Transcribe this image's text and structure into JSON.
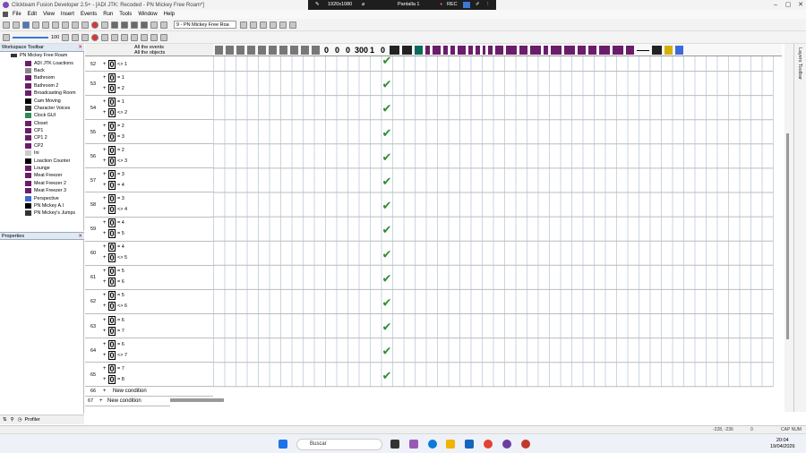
{
  "window": {
    "title": "Clickteam Fusion Developer 2.5+ - [ADI JTK: Recoded - PN Mickey Free Roam*]"
  },
  "recorder": {
    "resolution": "1920x1080",
    "screen": "Pantalla 1",
    "rec": "REC"
  },
  "menu": [
    "File",
    "Edit",
    "View",
    "Insert",
    "Events",
    "Run",
    "Tools",
    "Window",
    "Help"
  ],
  "toolbar": {
    "zoom": "100",
    "frame_selector": "9 - PN Mickey Free Roa"
  },
  "workspace": {
    "title": "Workspace Toolbar",
    "root": "PN Mickey Free Roam",
    "items": [
      "ADI JTK Loactions",
      "Back",
      "Bathroom",
      "Bathroom 2",
      "Broadcasting Room",
      "Cam Moving",
      "Character Voices",
      "Clock GUI",
      "Closet",
      "CP1",
      "CP1 2",
      "CP2",
      "Ini",
      "Loaction Counter",
      "Lounge",
      "Meat Freezer",
      "Meat Freezer 2",
      "Meat Freezer 3",
      "Perspective",
      "PN Mickey A.I",
      "PN Mickey's Jumps"
    ]
  },
  "properties": {
    "title": "Properties"
  },
  "profiler": {
    "label": "Profiler"
  },
  "editor": {
    "header_events": "All the events",
    "header_objects": "All the objects",
    "rows": [
      {
        "num": "52",
        "c1": "",
        "c2": "<> 1",
        "partial": true
      },
      {
        "num": "53",
        "c1": "= 1",
        "c2": "= 2"
      },
      {
        "num": "54",
        "c1": "= 1",
        "c2": "<> 2"
      },
      {
        "num": "55",
        "c1": "= 2",
        "c2": "= 3"
      },
      {
        "num": "56",
        "c1": "= 2",
        "c2": "<> 3"
      },
      {
        "num": "57",
        "c1": "= 3",
        "c2": "= 4"
      },
      {
        "num": "58",
        "c1": "= 3",
        "c2": "<> 4"
      },
      {
        "num": "59",
        "c1": "= 4",
        "c2": "= 5"
      },
      {
        "num": "60",
        "c1": "= 4",
        "c2": "<> 5"
      },
      {
        "num": "61",
        "c1": "= 5",
        "c2": "= 6"
      },
      {
        "num": "62",
        "c1": "= 5",
        "c2": "<> 6"
      },
      {
        "num": "63",
        "c1": "= 6",
        "c2": "= 7"
      },
      {
        "num": "64",
        "c1": "= 6",
        "c2": "<> 7"
      },
      {
        "num": "65",
        "c1": "= 7",
        "c2": "= 8"
      }
    ],
    "row66": {
      "num": "66",
      "label": "New condition"
    },
    "row67": {
      "num": "67",
      "label": "New condition"
    },
    "counter_labels": [
      "0",
      "0",
      "0",
      "300",
      "1",
      "0"
    ],
    "zero_char": "0",
    "check_char": "✔",
    "plus": "+"
  },
  "right_dock": {
    "label": "Layers Toolbar"
  },
  "statusbar": {
    "coords": "-228, -236",
    "value": "0",
    "caps": "CAP NUM"
  },
  "taskbar": {
    "search": "Buscar",
    "time": "20:04",
    "date": "19/04/2026"
  },
  "colors": {
    "accent_purple": "#6b1d6b",
    "check_green": "#2e8b2e"
  }
}
